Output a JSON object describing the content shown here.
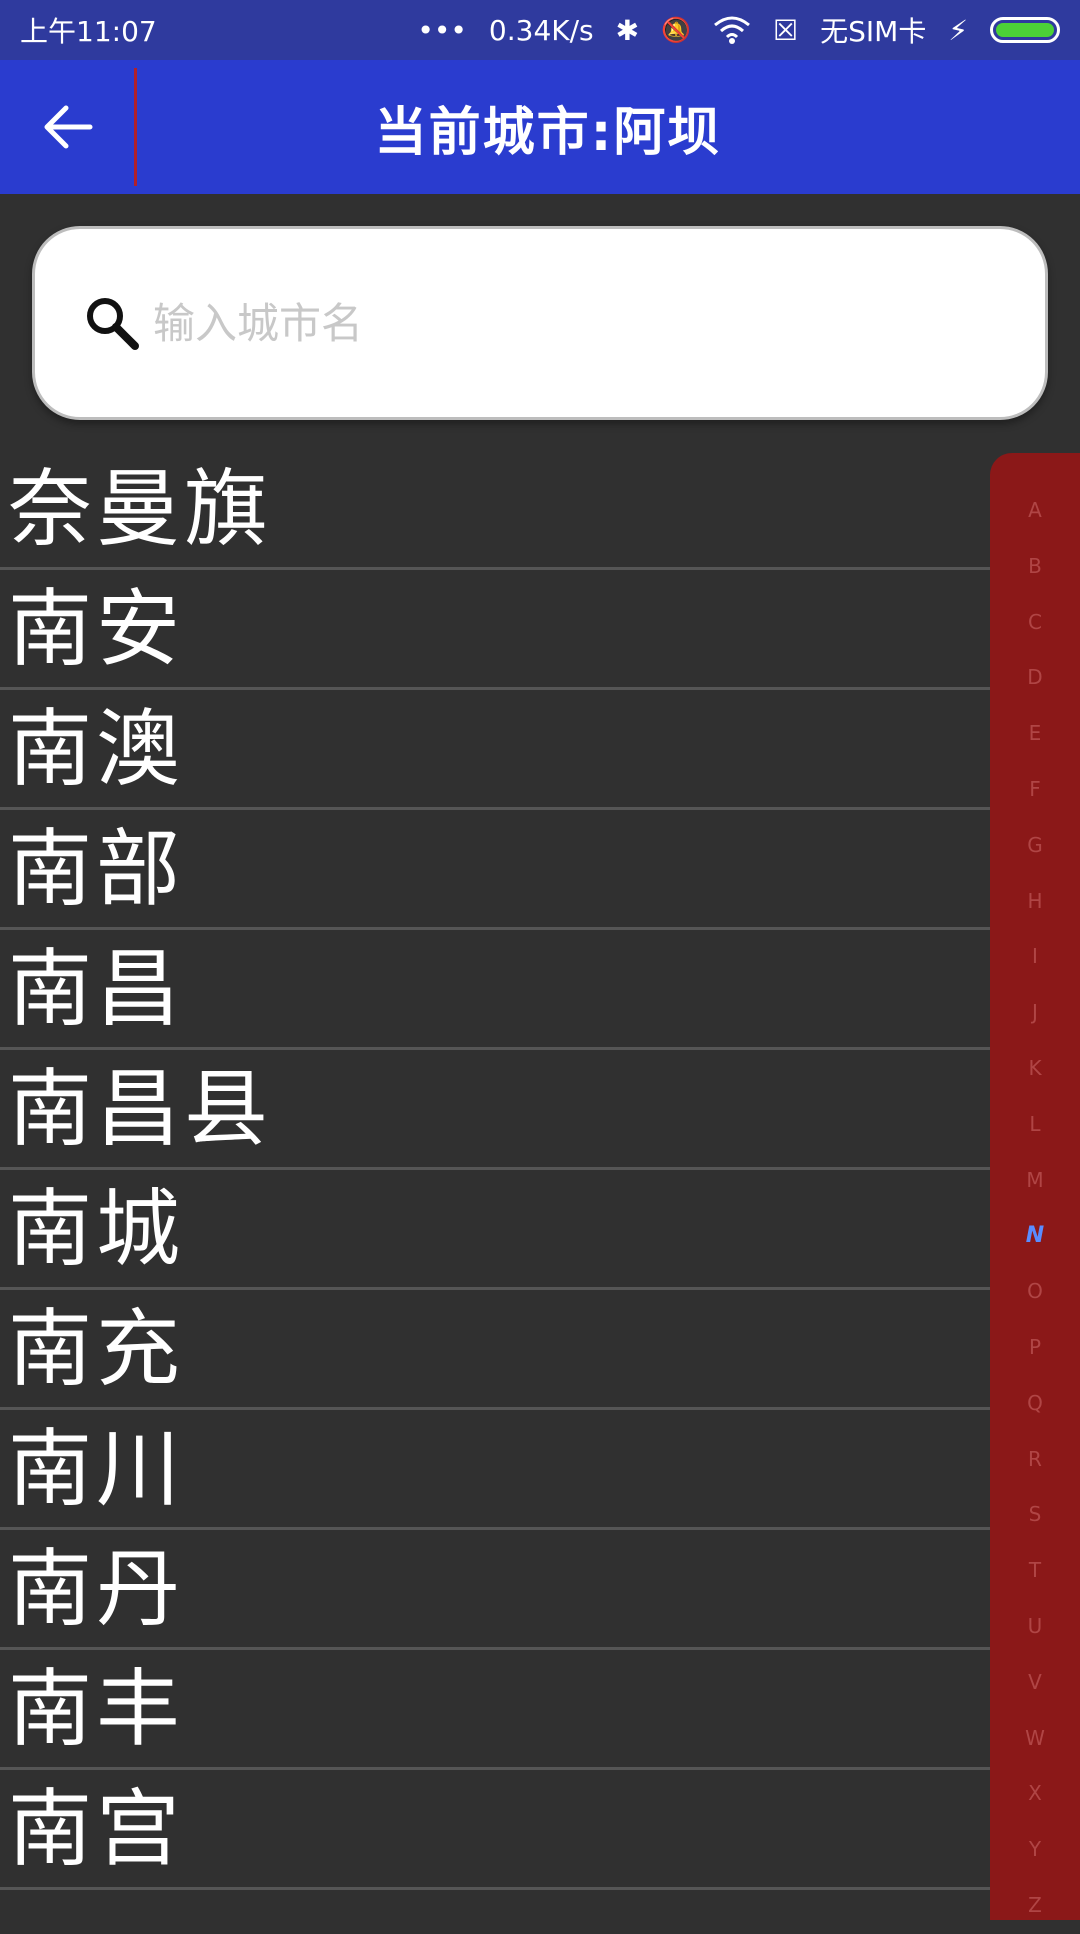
{
  "status_bar": {
    "time": "上午11:07",
    "dots": "•••",
    "speed": "0.34K/s",
    "bluetooth": "✱",
    "mute": "🔕",
    "wifi": "wifi-icon",
    "sim_x": "☒",
    "no_sim": "无SIM卡",
    "charging": "⚡",
    "battery_color": "#4cd137"
  },
  "app_bar": {
    "back_icon": "arrow-left-icon",
    "title": "当前城市:阿坝",
    "color": "#2a3ccf"
  },
  "search": {
    "placeholder": "输入城市名",
    "value": ""
  },
  "cities": [
    "奈曼旗",
    "南安",
    "南澳",
    "南部",
    "南昌",
    "南昌县",
    "南城",
    "南充",
    "南川",
    "南丹",
    "南丰",
    "南宫"
  ],
  "alpha_index": {
    "letters": [
      "A",
      "B",
      "C",
      "D",
      "E",
      "F",
      "G",
      "H",
      "I",
      "J",
      "K",
      "L",
      "M",
      "N",
      "O",
      "P",
      "Q",
      "R",
      "S",
      "T",
      "U",
      "V",
      "W",
      "X",
      "Y",
      "Z"
    ],
    "active": "N",
    "background": "#8b1818"
  }
}
